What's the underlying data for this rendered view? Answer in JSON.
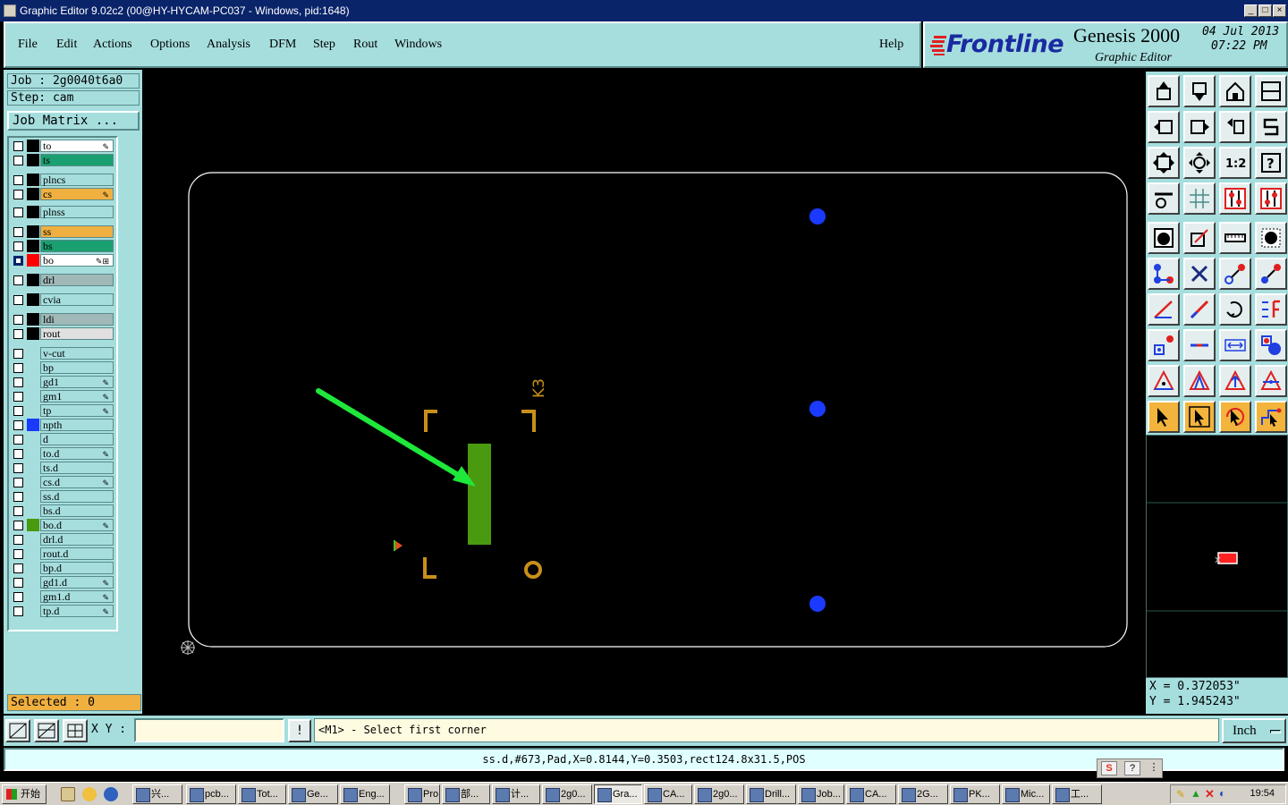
{
  "window": {
    "title": "Graphic Editor 9.02c2 (00@HY-HYCAM-PC037 - Windows, pid:1648)",
    "controls": [
      "_",
      "□",
      "×"
    ]
  },
  "menu": {
    "items": [
      "File",
      "Edit",
      "Actions",
      "Options",
      "Analysis",
      "DFM",
      "Step",
      "Rout",
      "Windows"
    ],
    "help": "Help"
  },
  "brand": {
    "logo": "Frontline",
    "product": "Genesis 2000",
    "subtitle": "Graphic Editor",
    "date": "04 Jul 2013",
    "time": "07:22 PM"
  },
  "job": {
    "job_line": "Job : 2g0040t6a0",
    "step_line": "Step: cam",
    "matrix_button": "Job Matrix ...",
    "selected": "Selected : 0"
  },
  "layers": [
    {
      "name": "to",
      "color": "#ffffff",
      "mark": "✎",
      "checked": false,
      "swatch": "#000000"
    },
    {
      "name": "ts",
      "color": "#1aa070",
      "mark": "",
      "checked": false,
      "swatch": "#000000"
    },
    {
      "name": "plncs",
      "color": "#a6dede",
      "mark": "",
      "checked": false,
      "swatch": "#000000"
    },
    {
      "name": "cs",
      "color": "#f0b040",
      "mark": "✎",
      "checked": false,
      "swatch": "#000000"
    },
    {
      "name": "plnss",
      "color": "#a6dede",
      "mark": "",
      "checked": false,
      "swatch": "#000000"
    },
    {
      "name": "ss",
      "color": "#f0b040",
      "mark": "",
      "checked": false,
      "swatch": "#000000"
    },
    {
      "name": "bs",
      "color": "#1aa070",
      "mark": "",
      "checked": false,
      "swatch": "#000000"
    },
    {
      "name": "bo",
      "color": "#ffffff",
      "mark": "✎⊞",
      "checked": true,
      "swatch": "#ff0000"
    },
    {
      "name": "drl",
      "color": "#a0b8b8",
      "mark": "",
      "checked": false,
      "swatch": "#000000"
    },
    {
      "name": "cvia",
      "color": "#a6dede",
      "mark": "",
      "checked": false,
      "swatch": "#000000"
    },
    {
      "name": "ldi",
      "color": "#a0b8b8",
      "mark": "",
      "checked": false,
      "swatch": "#000000"
    },
    {
      "name": "rout",
      "color": "#e0e0e0",
      "mark": "",
      "checked": false,
      "swatch": "#000000"
    },
    {
      "name": "v-cut",
      "color": "#a6dede",
      "mark": "",
      "checked": false,
      "swatch": "#a6dede"
    },
    {
      "name": "bp",
      "color": "#a6dede",
      "mark": "",
      "checked": false,
      "swatch": "#a6dede"
    },
    {
      "name": "gd1",
      "color": "#a6dede",
      "mark": "✎",
      "checked": false,
      "swatch": "#a6dede"
    },
    {
      "name": "gm1",
      "color": "#a6dede",
      "mark": "✎",
      "checked": false,
      "swatch": "#a6dede"
    },
    {
      "name": "tp",
      "color": "#a6dede",
      "mark": "✎",
      "checked": false,
      "swatch": "#a6dede"
    },
    {
      "name": "npth",
      "color": "#a6dede",
      "mark": "",
      "checked": false,
      "swatch": "#1a3aff"
    },
    {
      "name": "d",
      "color": "#a6dede",
      "mark": "",
      "checked": false,
      "swatch": "#a6dede"
    },
    {
      "name": "to.d",
      "color": "#a6dede",
      "mark": "✎",
      "checked": false,
      "swatch": "#a6dede"
    },
    {
      "name": "ts.d",
      "color": "#a6dede",
      "mark": "",
      "checked": false,
      "swatch": "#a6dede"
    },
    {
      "name": "cs.d",
      "color": "#a6dede",
      "mark": "✎",
      "checked": false,
      "swatch": "#a6dede"
    },
    {
      "name": "ss.d",
      "color": "#a6dede",
      "mark": "",
      "checked": false,
      "swatch": "#a6dede"
    },
    {
      "name": "bs.d",
      "color": "#a6dede",
      "mark": "",
      "checked": false,
      "swatch": "#a6dede"
    },
    {
      "name": "bo.d",
      "color": "#a6dede",
      "mark": "✎",
      "checked": false,
      "swatch": "#4a9a10"
    },
    {
      "name": "drl.d",
      "color": "#a6dede",
      "mark": "",
      "checked": false,
      "swatch": "#a6dede"
    },
    {
      "name": "rout.d",
      "color": "#a6dede",
      "mark": "",
      "checked": false,
      "swatch": "#a6dede"
    },
    {
      "name": "bp.d",
      "color": "#a6dede",
      "mark": "",
      "checked": false,
      "swatch": "#a6dede"
    },
    {
      "name": "gd1.d",
      "color": "#a6dede",
      "mark": "✎",
      "checked": false,
      "swatch": "#a6dede"
    },
    {
      "name": "gm1.d",
      "color": "#a6dede",
      "mark": "✎",
      "checked": false,
      "swatch": "#a6dede"
    },
    {
      "name": "tp.d",
      "color": "#a6dede",
      "mark": "✎",
      "checked": false,
      "swatch": "#a6dede"
    }
  ],
  "canvas": {
    "silk_label": "K3",
    "colors": {
      "outline": "#ffffff",
      "pad": "#4a9a10",
      "silk": "#c8901a",
      "arrow": "#1ee83a",
      "drill": "#1a3aff"
    }
  },
  "tools": [
    {
      "name": "step-up-icon",
      "sel": false
    },
    {
      "name": "step-down-icon",
      "sel": false
    },
    {
      "name": "home-icon",
      "sel": false
    },
    {
      "name": "split-view-icon",
      "sel": false
    },
    {
      "name": "pan-left-icon",
      "sel": false
    },
    {
      "name": "pan-right-icon",
      "sel": false
    },
    {
      "name": "undo-zoom-icon",
      "sel": false
    },
    {
      "name": "redraw-icon",
      "sel": false
    },
    {
      "name": "zoom-fit-icon",
      "sel": false
    },
    {
      "name": "zoom-center-icon",
      "sel": false
    },
    {
      "name": "zoom-1-2-icon",
      "sel": false
    },
    {
      "name": "help-query-icon",
      "sel": false
    },
    {
      "name": "measure-settings-icon",
      "sel": false
    },
    {
      "name": "grid-icon",
      "sel": false
    },
    {
      "name": "snap-red-icon",
      "sel": false
    },
    {
      "name": "snap-red-alt-icon",
      "sel": false
    },
    {
      "name": "pad-highlight-icon",
      "sel": false
    },
    {
      "name": "shape-edit-icon",
      "sel": false
    },
    {
      "name": "ruler-icon",
      "sel": false
    },
    {
      "name": "pad-dot-icon",
      "sel": false
    },
    {
      "name": "net-connect-icon",
      "sel": false
    },
    {
      "name": "cross-icon",
      "sel": false
    },
    {
      "name": "line-node-icon",
      "sel": false
    },
    {
      "name": "line-node-alt-icon",
      "sel": false
    },
    {
      "name": "angle-draw-icon",
      "sel": false
    },
    {
      "name": "slash-line-icon",
      "sel": false
    },
    {
      "name": "rotate-icon",
      "sel": false
    },
    {
      "name": "mirror-icon",
      "sel": false
    },
    {
      "name": "move-pad-icon",
      "sel": false
    },
    {
      "name": "line-minus-icon",
      "sel": false
    },
    {
      "name": "dimension-icon",
      "sel": false
    },
    {
      "name": "group-circles-icon",
      "sel": false
    },
    {
      "name": "delta-a-icon",
      "sel": false
    },
    {
      "name": "delta-b-icon",
      "sel": false
    },
    {
      "name": "delta-c-icon",
      "sel": false
    },
    {
      "name": "delta-d-icon",
      "sel": false
    },
    {
      "name": "pointer-select-icon",
      "sel": true
    },
    {
      "name": "pointer-box-icon",
      "sel": true
    },
    {
      "name": "pointer-rotate-icon",
      "sel": true
    },
    {
      "name": "pointer-route-icon",
      "sel": true
    }
  ],
  "coords": {
    "x": "X = 0.372053\"",
    "y": "Y = 1.945243\""
  },
  "command": {
    "xy_label": "X Y :",
    "xy_value": "",
    "excl": "!",
    "prompt": "<M1> - Select first corner",
    "unit": "Inch"
  },
  "status": "ss.d,#673,Pad,X=0.8144,Y=0.3503,rect124.8x31.5,POS",
  "taskbar": {
    "start": "开始",
    "tasks": [
      "兴...",
      "pcb...",
      "Tot...",
      "Ge...",
      "Eng...",
      "Pro...",
      "部...",
      "计...",
      "2g0...",
      "Gra...",
      "CA...",
      "2g0...",
      "Drill...",
      "Job...",
      "CA...",
      "2G...",
      "PK...",
      "Mic...",
      "工..."
    ],
    "active": 9,
    "clock": "19:54"
  }
}
